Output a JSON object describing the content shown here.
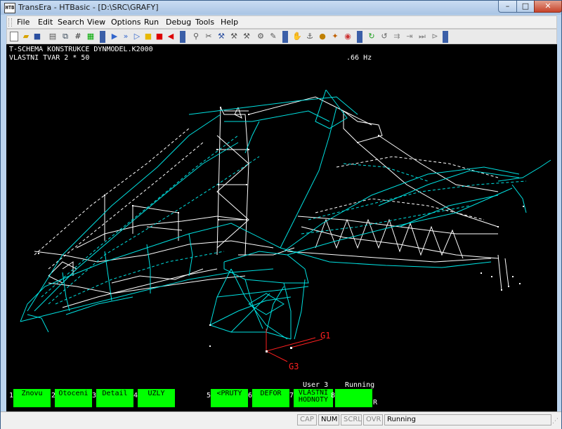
{
  "window": {
    "title": "TransEra - HTBasic - [D:\\SRC\\GRAFY]",
    "icon_text": "HTB",
    "buttons": {
      "minimize": "–",
      "maximize": "□",
      "close": "✕"
    }
  },
  "menu": [
    "File",
    "Edit",
    "Search",
    "View",
    "Options",
    "Run",
    "Debug",
    "Tools",
    "Help"
  ],
  "toolbar_icons": [
    "new-icon",
    "open-icon",
    "save-icon",
    "print-icon",
    "copy-icon",
    "hash-icon",
    "grid-icon",
    "run-icon",
    "continue-icon",
    "step-icon",
    "pause-icon",
    "stop-icon",
    "back-icon",
    "find-icon",
    "cut-icon",
    "wrench-icon",
    "hammer-icon",
    "tools-icon",
    "compile-icon",
    "edit-icon",
    "hand-icon",
    "breakpoint-icon",
    "watch-icon",
    "help-icon",
    "arrow-icon",
    "redo-icon",
    "undo-icon",
    "play-icon",
    "end-icon"
  ],
  "screen": {
    "header_line1": "T-SCHEMA KONSTRUKCE DYNMODEL.K2000",
    "header_line2": "VLASTNI TVAR 2 * 50",
    "frequency": ".66 Hz",
    "label_g1": "G1",
    "label_g3": "G3",
    "user_status": "User 3",
    "run_status": "Running",
    "r_marker": "R",
    "colors": {
      "structure_cyan": "#00e0e0",
      "structure_white": "#ffffff",
      "label_red": "#ff2020",
      "softkey_green": "#00ff00"
    }
  },
  "softkeys": [
    {
      "num": "1",
      "label": "Znovu"
    },
    {
      "num": "2",
      "label": "Otoceni"
    },
    {
      "num": "3",
      "label": "Detail"
    },
    {
      "num": "4",
      "label": "UZLY"
    },
    {
      "num": "5",
      "label": "<PRUTY"
    },
    {
      "num": "6",
      "label": "DEFOR"
    },
    {
      "num": "7",
      "label": "VLASTNI HODNOTY"
    },
    {
      "num": "8",
      "label": ""
    }
  ],
  "statusbar": {
    "cells": [
      {
        "label": "CAP",
        "active": false
      },
      {
        "label": "NUM",
        "active": true
      },
      {
        "label": "SCRL",
        "active": false
      },
      {
        "label": "OVR",
        "active": false
      },
      {
        "label": "Running",
        "active": true
      }
    ]
  }
}
